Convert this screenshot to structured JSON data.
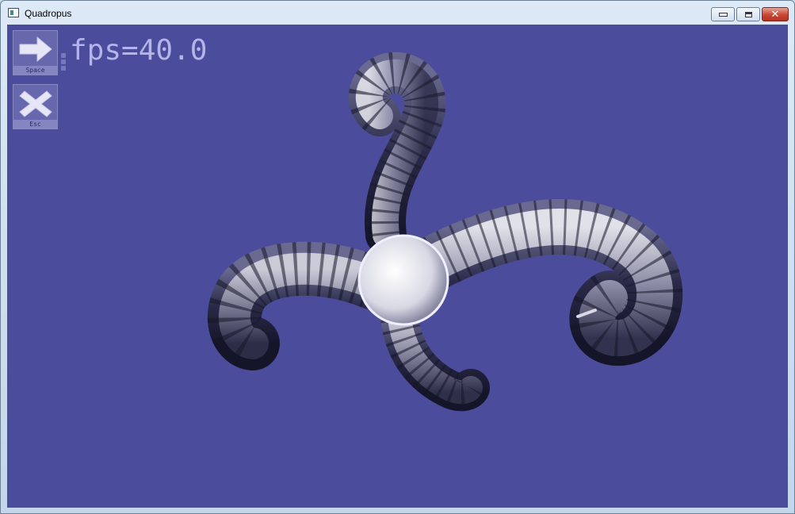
{
  "window": {
    "title": "Quadropus",
    "controls": {
      "minimize": "minimize",
      "maximize": "maximize",
      "close": "✕"
    }
  },
  "overlay": {
    "fps_text": "fps=40.0",
    "buttons": [
      {
        "label": "Space",
        "icon": "arrow-right-icon"
      },
      {
        "label": "Esc",
        "icon": "close-x-icon"
      }
    ]
  },
  "colors": {
    "background": "#4c4c9c",
    "fps_text": "#b4b4ea",
    "button_bg": "#6767ae"
  }
}
